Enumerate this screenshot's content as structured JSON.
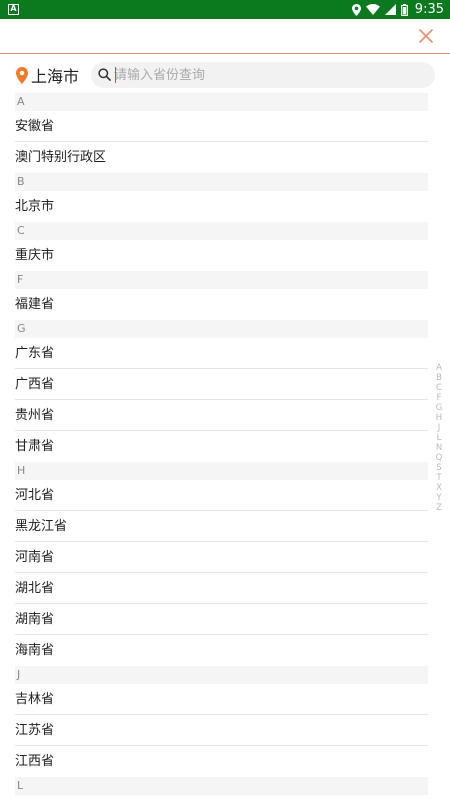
{
  "status_bar": {
    "time": "9:35",
    "app_icon_letter": "A",
    "icons": [
      "location-icon",
      "wifi-icon",
      "signal-icon",
      "battery-icon"
    ]
  },
  "header": {
    "close_icon": "close-icon",
    "accent_color": "#f08b70"
  },
  "location": {
    "city": "上海市",
    "pin_color": "#f07a2a"
  },
  "search": {
    "placeholder": "请输入省份查询",
    "value": ""
  },
  "sections": [
    {
      "letter": "A",
      "items": [
        "安徽省",
        "澳门特别行政区"
      ]
    },
    {
      "letter": "B",
      "items": [
        "北京市"
      ]
    },
    {
      "letter": "C",
      "items": [
        "重庆市"
      ]
    },
    {
      "letter": "F",
      "items": [
        "福建省"
      ]
    },
    {
      "letter": "G",
      "items": [
        "广东省",
        "广西省",
        "贵州省",
        "甘肃省"
      ]
    },
    {
      "letter": "H",
      "items": [
        "河北省",
        "黑龙江省",
        "河南省",
        "湖北省",
        "湖南省",
        "海南省"
      ]
    },
    {
      "letter": "J",
      "items": [
        "吉林省",
        "江苏省",
        "江西省"
      ]
    },
    {
      "letter": "L",
      "items": []
    }
  ],
  "index_letters": [
    "A",
    "B",
    "C",
    "F",
    "G",
    "H",
    "J",
    "L",
    "N",
    "Q",
    "S",
    "T",
    "X",
    "Y",
    "Z"
  ]
}
